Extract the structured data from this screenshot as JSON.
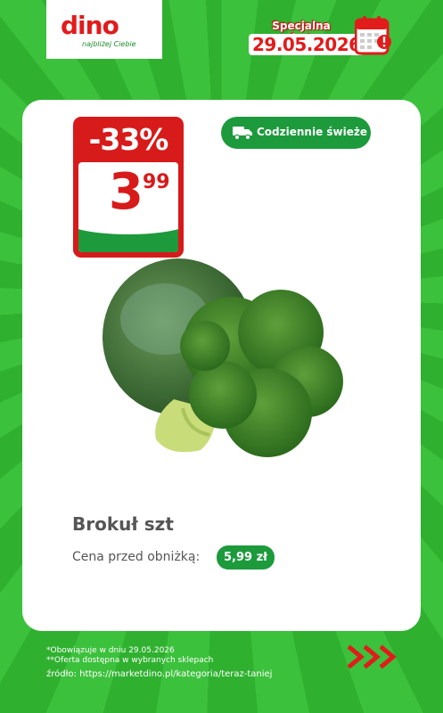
{
  "header": {
    "logo_text": "dino",
    "logo_tagline": "najbliżej Ciebie",
    "promo_label": "Specjalna oferta",
    "promo_date": "29.05.2026",
    "calendar_icon": "calendar-alert-icon"
  },
  "offer": {
    "discount": "-33%",
    "price_whole": "3",
    "price_cents": "99",
    "fresh_label": "Codziennie świeże",
    "fresh_icon": "delivery-truck-icon",
    "product_image": "broccoli",
    "product_name": "Brokuł szt",
    "before_label": "Cena przed obniżką:",
    "before_price": "5,99 zł"
  },
  "footer": {
    "note1": "*Obowiązuje w dniu 29.05.2026",
    "note2": "**Oferta dostępna w wybranych sklepach",
    "source": "źródło: https://marketdino.pl/kategoria/teraz-taniej",
    "arrows_icon": "triple-chevron-right-icon"
  },
  "colors": {
    "background_green": "#3cc13c",
    "brand_red": "#d71a1a",
    "accent_green": "#1c9a3c",
    "text_gray": "#555555"
  }
}
